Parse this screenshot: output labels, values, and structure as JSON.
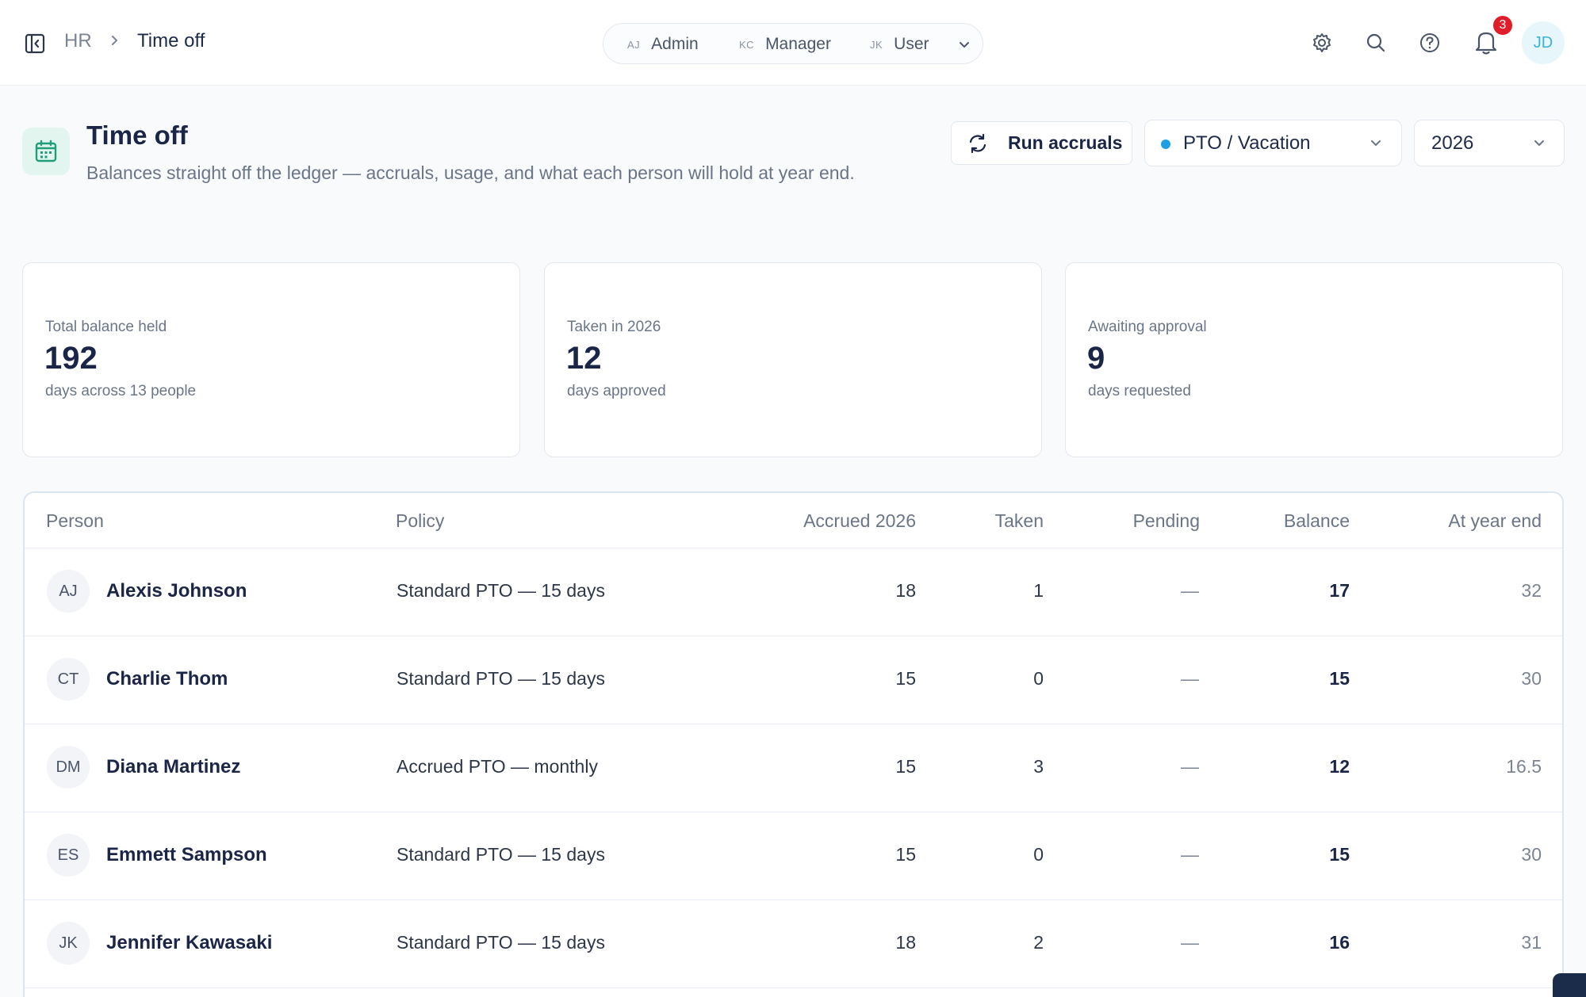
{
  "breadcrumb": {
    "root": "HR",
    "current": "Time off"
  },
  "roles": [
    {
      "initials": "AJ",
      "label": "Admin"
    },
    {
      "initials": "KC",
      "label": "Manager"
    },
    {
      "initials": "JK",
      "label": "User"
    }
  ],
  "header_icons": {
    "settings": "gear-icon",
    "search": "search-icon",
    "help": "help-icon",
    "notifications": "bell-icon"
  },
  "notifications": {
    "count": "3"
  },
  "user": {
    "initials": "JD"
  },
  "page": {
    "title": "Time off",
    "subtitle": "Balances straight off the ledger — accruals, usage, and what each person will hold at year end."
  },
  "toolbar": {
    "run_accruals": "Run accruals",
    "policy_select": "PTO / Vacation",
    "policy_dot_color": "#1ea0e6",
    "year_select": "2026"
  },
  "stats": [
    {
      "label": "Total balance held",
      "value": "192",
      "sub": "days across 13 people"
    },
    {
      "label": "Taken in 2026",
      "value": "12",
      "sub": "days approved"
    },
    {
      "label": "Awaiting approval",
      "value": "9",
      "sub": "days requested"
    }
  ],
  "table": {
    "columns": [
      "Person",
      "Policy",
      "Accrued 2026",
      "Taken",
      "Pending",
      "Balance",
      "At year end"
    ],
    "rows": [
      {
        "initials": "AJ",
        "name": "Alexis Johnson",
        "policy": "Standard PTO — 15 days",
        "accrued": "18",
        "taken": "1",
        "pending": "—",
        "balance": "17",
        "year_end": "32"
      },
      {
        "initials": "CT",
        "name": "Charlie Thom",
        "policy": "Standard PTO — 15 days",
        "accrued": "15",
        "taken": "0",
        "pending": "—",
        "balance": "15",
        "year_end": "30"
      },
      {
        "initials": "DM",
        "name": "Diana Martinez",
        "policy": "Accrued PTO — monthly",
        "accrued": "15",
        "taken": "3",
        "pending": "—",
        "balance": "12",
        "year_end": "16.5"
      },
      {
        "initials": "ES",
        "name": "Emmett Sampson",
        "policy": "Standard PTO — 15 days",
        "accrued": "15",
        "taken": "0",
        "pending": "—",
        "balance": "15",
        "year_end": "30"
      },
      {
        "initials": "JK",
        "name": "Jennifer Kawasaki",
        "policy": "Standard PTO — 15 days",
        "accrued": "18",
        "taken": "2",
        "pending": "—",
        "balance": "16",
        "year_end": "31"
      }
    ]
  },
  "colors": {
    "accent": "#1ea0e6",
    "badge": "#e11d2a",
    "title": "#1a2547"
  }
}
